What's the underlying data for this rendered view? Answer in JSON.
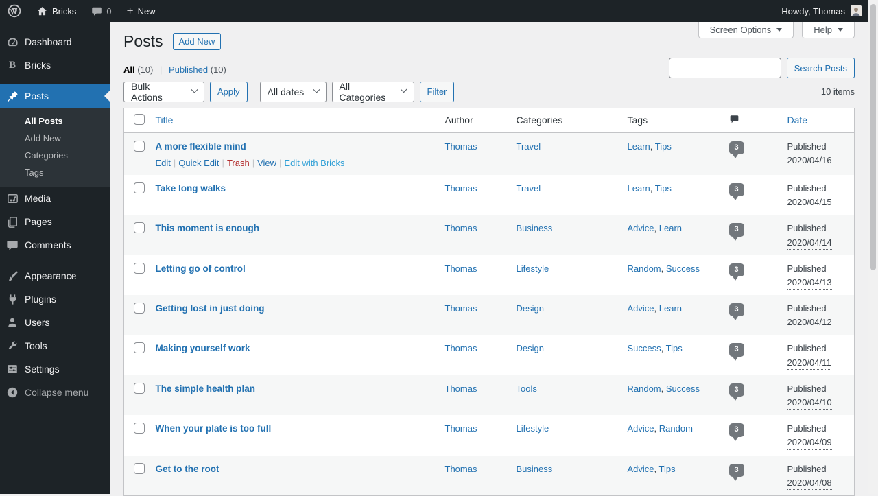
{
  "admin_bar": {
    "site_name": "Bricks",
    "comment_count": "0",
    "new_label": "New",
    "howdy": "Howdy, Thomas"
  },
  "sidebar": {
    "dashboard": "Dashboard",
    "bricks": "Bricks",
    "bricks_initial": "B",
    "posts": "Posts",
    "submenu": {
      "all_posts": "All Posts",
      "add_new": "Add New",
      "categories": "Categories",
      "tags": "Tags"
    },
    "media": "Media",
    "pages": "Pages",
    "comments": "Comments",
    "appearance": "Appearance",
    "plugins": "Plugins",
    "users": "Users",
    "tools": "Tools",
    "settings": "Settings",
    "collapse": "Collapse menu"
  },
  "header": {
    "page_title": "Posts",
    "add_new": "Add New",
    "screen_options": "Screen Options",
    "help": "Help"
  },
  "views": {
    "all": "All",
    "all_count": "(10)",
    "published": "Published",
    "published_count": "(10)",
    "sep": "|"
  },
  "search": {
    "value": "",
    "button": "Search Posts"
  },
  "tablenav": {
    "bulk_actions": "Bulk Actions",
    "apply": "Apply",
    "all_dates": "All dates",
    "all_categories": "All Categories",
    "filter": "Filter",
    "items": "10 items"
  },
  "table": {
    "headers": {
      "title": "Title",
      "author": "Author",
      "categories": "Categories",
      "tags": "Tags",
      "date": "Date"
    },
    "action_sep": "|",
    "tag_sep": ",",
    "row_actions": {
      "edit": "Edit",
      "quick_edit": "Quick Edit",
      "trash": "Trash",
      "view": "View",
      "bricks": "Edit with Bricks"
    },
    "rows": [
      {
        "title": "A more flexible mind",
        "author": "Thomas",
        "category": "Travel",
        "tags": [
          "Learn",
          "Tips"
        ],
        "comments": "3",
        "status": "Published",
        "date": "2020/04/16"
      },
      {
        "title": "Take long walks",
        "author": "Thomas",
        "category": "Travel",
        "tags": [
          "Learn",
          "Tips"
        ],
        "comments": "3",
        "status": "Published",
        "date": "2020/04/15"
      },
      {
        "title": "This moment is enough",
        "author": "Thomas",
        "category": "Business",
        "tags": [
          "Advice",
          "Learn"
        ],
        "comments": "3",
        "status": "Published",
        "date": "2020/04/14"
      },
      {
        "title": "Letting go of control",
        "author": "Thomas",
        "category": "Lifestyle",
        "tags": [
          "Random",
          "Success"
        ],
        "comments": "3",
        "status": "Published",
        "date": "2020/04/13"
      },
      {
        "title": "Getting lost in just doing",
        "author": "Thomas",
        "category": "Design",
        "tags": [
          "Advice",
          "Learn"
        ],
        "comments": "3",
        "status": "Published",
        "date": "2020/04/12"
      },
      {
        "title": "Making yourself work",
        "author": "Thomas",
        "category": "Design",
        "tags": [
          "Success",
          "Tips"
        ],
        "comments": "3",
        "status": "Published",
        "date": "2020/04/11"
      },
      {
        "title": "The simple health plan",
        "author": "Thomas",
        "category": "Tools",
        "tags": [
          "Random",
          "Success"
        ],
        "comments": "3",
        "status": "Published",
        "date": "2020/04/10"
      },
      {
        "title": "When your plate is too full",
        "author": "Thomas",
        "category": "Lifestyle",
        "tags": [
          "Advice",
          "Random"
        ],
        "comments": "3",
        "status": "Published",
        "date": "2020/04/09"
      },
      {
        "title": "Get to the root",
        "author": "Thomas",
        "category": "Business",
        "tags": [
          "Advice",
          "Tips"
        ],
        "comments": "3",
        "status": "Published",
        "date": "2020/04/08"
      }
    ]
  },
  "colors": {
    "accent_blue": "#2271b1",
    "trash_red": "#b32d2e",
    "bricks_link_blue": "#2e9fd6",
    "bubble_grey": "#72777c",
    "admin_bg": "#1d2327",
    "submenu_bg": "#2c3338",
    "row_stripe": "#f6f7f7"
  }
}
